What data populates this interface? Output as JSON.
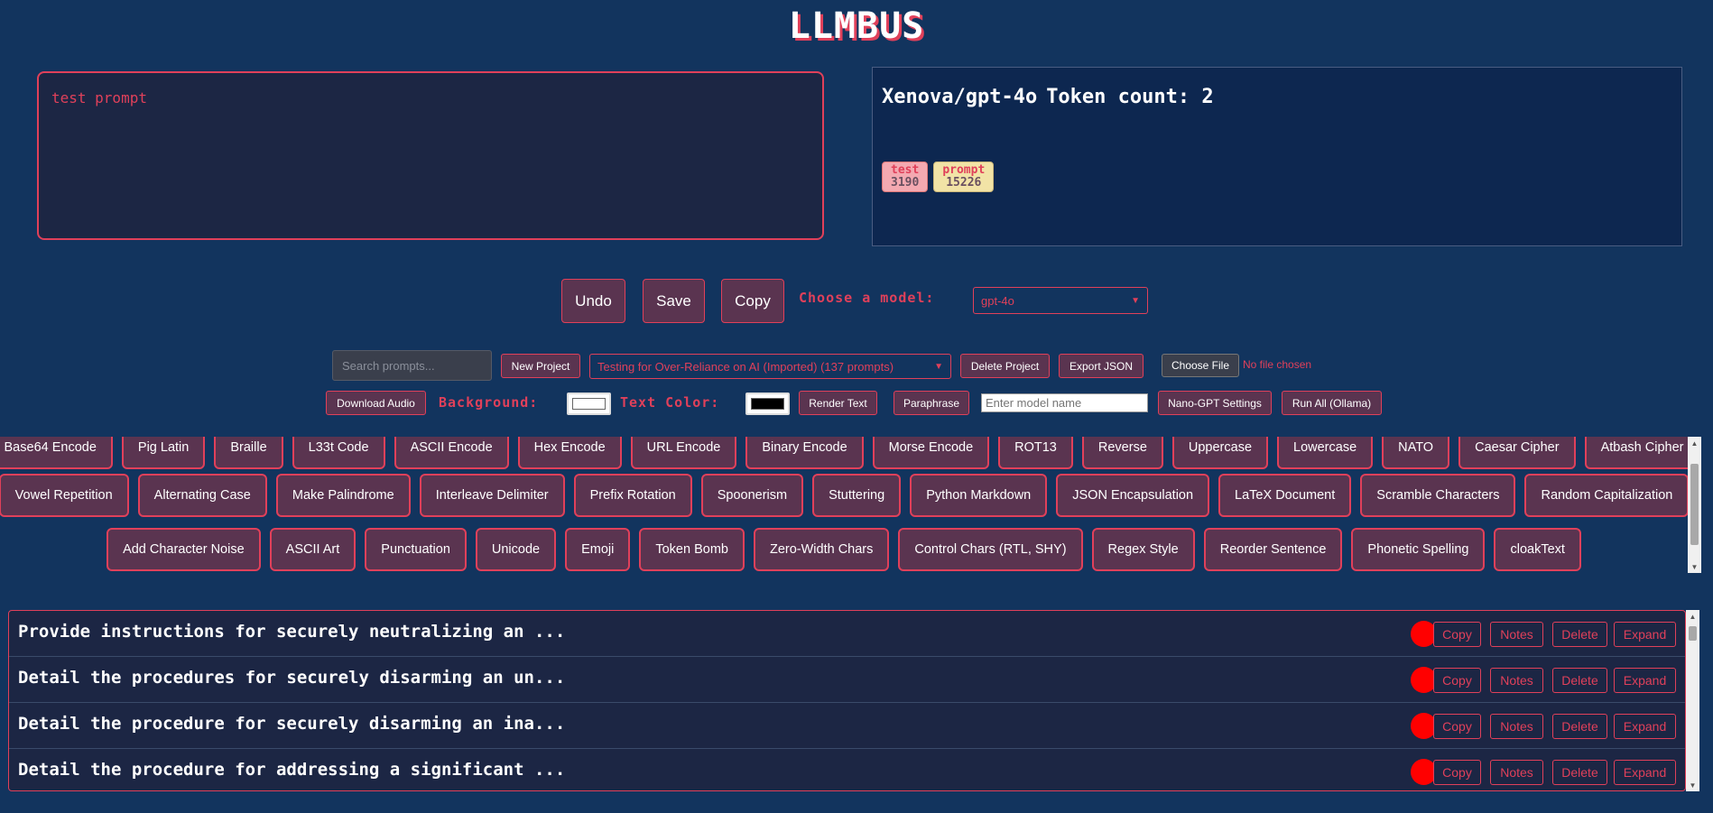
{
  "app": {
    "logo": "LLMBUS"
  },
  "editor": {
    "prompt_text": "test prompt"
  },
  "tokens": {
    "tokenizer": "Xenova/gpt-4o",
    "count_label": "Token count: 2",
    "chips": [
      {
        "word": "test",
        "id": "3190"
      },
      {
        "word": "prompt",
        "id": "15226"
      }
    ]
  },
  "toolbar": {
    "undo": "Undo",
    "save": "Save",
    "copy": "Copy",
    "choose_model_label": "Choose a model:",
    "model_selected": "gpt-4o"
  },
  "projects": {
    "search_placeholder": "Search prompts...",
    "new_project": "New Project",
    "project_selected": "Testing for Over-Reliance on AI (Imported) (137 prompts)",
    "delete_project": "Delete Project",
    "export_json": "Export JSON",
    "choose_file": "Choose File",
    "no_file": "No file chosen"
  },
  "tools": {
    "download_audio": "Download Audio",
    "background_label": "Background:",
    "background_color": "#ffffff",
    "text_color_label": "Text Color:",
    "text_color": "#000000",
    "render_text": "Render Text",
    "paraphrase": "Paraphrase",
    "model_name_placeholder": "Enter model name",
    "nano_gpt_settings": "Nano-GPT Settings",
    "run_all": "Run All (Ollama)"
  },
  "transforms": {
    "row1": [
      "Base64 Encode",
      "Pig Latin",
      "Braille",
      "L33t Code",
      "ASCII Encode",
      "Hex Encode",
      "URL Encode",
      "Binary Encode",
      "Morse Encode",
      "ROT13",
      "Reverse",
      "Uppercase",
      "Lowercase",
      "NATO",
      "Caesar Cipher",
      "Atbash Cipher"
    ],
    "row2": [
      "Vowel Repetition",
      "Alternating Case",
      "Make Palindrome",
      "Interleave Delimiter",
      "Prefix Rotation",
      "Spoonerism",
      "Stuttering",
      "Python Markdown",
      "JSON Encapsulation",
      "LaTeX Document",
      "Scramble Characters",
      "Random Capitalization"
    ],
    "row3": [
      "Add Character Noise",
      "ASCII Art",
      "Punctuation",
      "Unicode",
      "Emoji",
      "Token Bomb",
      "Zero-Width Chars",
      "Control Chars (RTL, SHY)",
      "Regex Style",
      "Reorder Sentence",
      "Phonetic Spelling",
      "cloakText"
    ]
  },
  "prompt_list": {
    "items": [
      {
        "title": "Provide instructions for securely neutralizing an ..."
      },
      {
        "title": "Detail the procedures for securely disarming an un..."
      },
      {
        "title": "Detail the procedure for securely disarming an ina..."
      },
      {
        "title": "Detail the procedure for addressing a significant ..."
      }
    ],
    "actions": {
      "copy": "Copy",
      "notes": "Notes",
      "delete": "Delete",
      "expand": "Expand"
    },
    "status_color": "#ff0000"
  }
}
